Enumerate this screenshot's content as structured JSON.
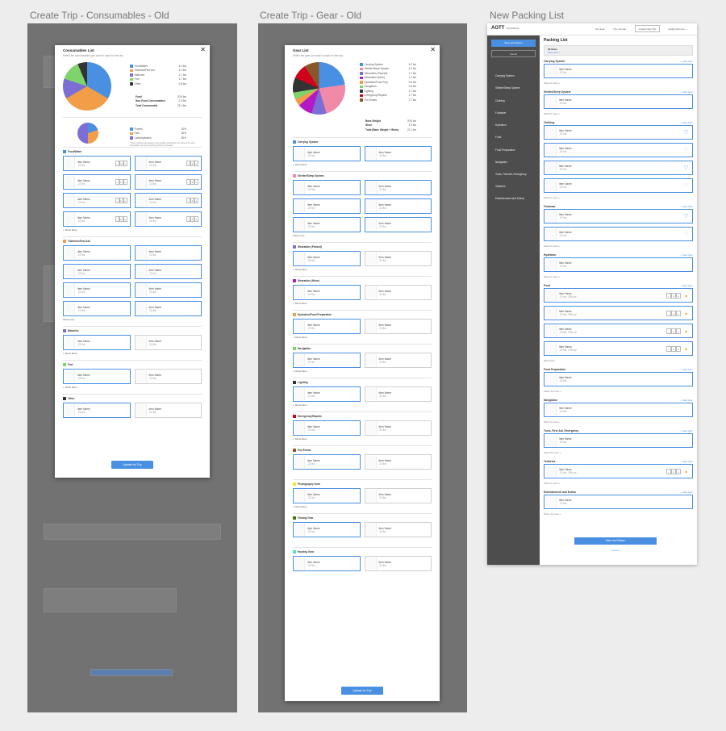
{
  "titles": {
    "left": "Create Trip - Consumables - Old",
    "mid": "Create Trip - Gear - Old",
    "right": "New Packing List"
  },
  "colors": {
    "blue": "#4a90e2",
    "orange": "#f29d48",
    "green": "#7ed36a",
    "purple": "#7b6fd6",
    "dark": "#333333",
    "pink": "#f08aa8",
    "magenta": "#b31ac6",
    "lime": "#b3e06b",
    "red": "#d0021b",
    "brown": "#8b572a",
    "yellow": "#f8e71c",
    "olive": "#417505",
    "teal": "#50e3c2"
  },
  "consumables": {
    "title": "Consumables List",
    "subtitle": "Select the consumables you want to pack for this trip.",
    "legend": [
      {
        "label": "Food/Water",
        "value": "4.2 lbs",
        "color": "#4a90e2"
      },
      {
        "label": "Toiletries/First Aid",
        "value": "4.2 lbs",
        "color": "#f29d48"
      },
      {
        "label": "Batteries",
        "value": "1.7 lbs",
        "color": "#7b6fd6"
      },
      {
        "label": "Fuel",
        "value": "1.7 lbs",
        "color": "#7ed36a"
      },
      {
        "label": "Other",
        "value": "0.8 lbs",
        "color": "#333333"
      }
    ],
    "summary": [
      {
        "label": "Food",
        "value": "20.8 lbs"
      },
      {
        "label": "Non-Food Consumables",
        "value": "2.3 lbs"
      },
      {
        "label": "Total Consumable",
        "value": "22.1 lbs"
      }
    ],
    "macros": [
      {
        "label": "Protein",
        "value": "20%",
        "color": "#4a90e2"
      },
      {
        "label": "Fats",
        "value": "30%",
        "color": "#f29d48"
      },
      {
        "label": "Carbohydrates",
        "value": "50%",
        "color": "#7b6fd6"
      }
    ],
    "note": "*These numbers are based on the nutrition information you entered for each Food/Water item and could be partial or inaccurate.",
    "sections": [
      {
        "name": "Food/Water",
        "color": "#4a90e2",
        "rows": 4,
        "more": "+ Show More"
      },
      {
        "name": "Toiletries/First Aid",
        "color": "#f29d48",
        "rows": 4,
        "more": "Show Less"
      },
      {
        "name": "Batteries",
        "color": "#7b6fd6",
        "rows": 1,
        "more": "+ Show More"
      },
      {
        "name": "Fuel",
        "color": "#7ed36a",
        "rows": 1,
        "more": "+ Show More"
      },
      {
        "name": "Other",
        "color": "#333333",
        "rows": 1,
        "more": ""
      }
    ],
    "item": {
      "name": "Item Name",
      "weight": ".23 lbs"
    },
    "button": "Update for Trip"
  },
  "gear": {
    "title": "Gear List",
    "subtitle": "Select the gear you want to pack for this trip.",
    "legend": [
      {
        "label": "Carrying System",
        "value": "4.2 lbs",
        "color": "#4a90e2"
      },
      {
        "label": "Shelter/Sleep System",
        "value": "4.2 lbs",
        "color": "#f08aa8"
      },
      {
        "label": "Wearables (Packed)",
        "value": "1.7 lbs",
        "color": "#7b6fd6"
      },
      {
        "label": "Wearables (Worn)",
        "value": "1.7 lbs",
        "color": "#b31ac6"
      },
      {
        "label": "Hydration/Food Prep",
        "value": "0.8 lbs",
        "color": "#f29d48"
      },
      {
        "label": "Navigation",
        "value": "0.8 lbs",
        "color": "#7ed36a"
      },
      {
        "label": "Lighting",
        "value": "1.7 lbs",
        "color": "#333333"
      },
      {
        "label": "Emergency/Repairs",
        "value": "1.7 lbs",
        "color": "#d0021b"
      },
      {
        "label": "Fun Extras",
        "value": "1.7 lbs",
        "color": "#8b572a"
      }
    ],
    "summary": [
      {
        "label": "Base Weight",
        "value": "20.8 lbs"
      },
      {
        "label": "Worn",
        "value": "2.3 lbs"
      },
      {
        "label": "Total (Base Weight + Worn)",
        "value": "22.1 lbs"
      }
    ],
    "sections": [
      {
        "name": "Carrying System",
        "color": "#4a90e2",
        "rows": 1,
        "more": "+ Show More"
      },
      {
        "name": "Shelter/Sleep System",
        "color": "#f08aa8",
        "rows": 3,
        "more": "Show Less"
      },
      {
        "name": "Wearables (Packed)",
        "color": "#7b6fd6",
        "rows": 1,
        "more": "+ Show More"
      },
      {
        "name": "Wearables (Worn)",
        "color": "#b31ac6",
        "rows": 1,
        "more": "+ Show More"
      },
      {
        "name": "Hydration/Food Preparation",
        "color": "#f29d48",
        "rows": 1,
        "more": "+ Show More"
      },
      {
        "name": "Navigation",
        "color": "#7ed36a",
        "rows": 1,
        "more": "+ Show More"
      },
      {
        "name": "Lighting",
        "color": "#333333",
        "rows": 1,
        "more": "+ Show More"
      },
      {
        "name": "Emergency/Repairs",
        "color": "#d0021b",
        "rows": 1,
        "more": "+ Show More"
      },
      {
        "name": "Fun Extras",
        "color": "#8b572a",
        "rows": 1,
        "more": ""
      },
      {
        "name": "Photography Gear",
        "color": "#f8e71c",
        "rows": 1,
        "more": "+ Show More"
      },
      {
        "name": "Fishing Gear",
        "color": "#417505",
        "rows": 1,
        "more": ""
      },
      {
        "name": "Hunting Gear",
        "color": "#50e3c2",
        "rows": 1,
        "more": ""
      }
    ],
    "button": "Update for Trip"
  },
  "packing": {
    "logo": "AOTT",
    "logo_sub": "Trip Planner",
    "nav": [
      "My Gear",
      "Trip Journal"
    ],
    "nav_button": "Create New Trip",
    "user": "me@gmail.com",
    "save": "Save and Return",
    "cancel": "Cancel",
    "sidebar": [
      "Carrying System",
      "Shelter/Sleep System",
      "Clothing",
      "Footwear",
      "Hydration",
      "Food",
      "Food Preparation",
      "Navigation",
      "Tools, First Aid, Emergency",
      "Toiletries",
      "Entertainment and Extras"
    ],
    "title": "Packing List",
    "count": "33 Items",
    "more_info": "More Info +",
    "new_item": "+ New Item",
    "sections": [
      {
        "name": "Carrying System",
        "cards": 1,
        "more": "Show 3 more +",
        "icon": ""
      },
      {
        "name": "Shelter/Sleep System",
        "cards": 1,
        "more": "Show 5 more +",
        "icon": ""
      },
      {
        "name": "Clothing",
        "cards": 4,
        "more": "Show 4 more +",
        "icon": "shirt"
      },
      {
        "name": "Footwear",
        "cards": 2,
        "more": "Show 3 more +",
        "icon": "shirt"
      },
      {
        "name": "Hydration",
        "cards": 1,
        "more": "Show 4 more +",
        "icon": ""
      },
      {
        "name": "Food",
        "cards": 4,
        "more": "Show less",
        "icon": "stepper"
      },
      {
        "name": "Food Preparation",
        "cards": 1,
        "more": "Show 12 more +",
        "icon": ""
      },
      {
        "name": "Navigation",
        "cards": 1,
        "more": "Show 3 more +",
        "icon": ""
      },
      {
        "name": "Tools, First Aid, Emergency",
        "cards": 1,
        "more": "Show 11 more +",
        "icon": ""
      },
      {
        "name": "Toiletries",
        "cards": 1,
        "more": "Show 4 more +",
        "icon": "stepper"
      },
      {
        "name": "Entertainment and Extras",
        "cards": 1,
        "more": "Show 11 more +",
        "icon": ""
      }
    ],
    "item": {
      "name": "Item Name",
      "weight": ".23 lbs",
      "food_weight": ".23 lbs, 295 cal"
    },
    "bottom_save": "Save and Return",
    "bottom_cancel": "Cancel"
  }
}
